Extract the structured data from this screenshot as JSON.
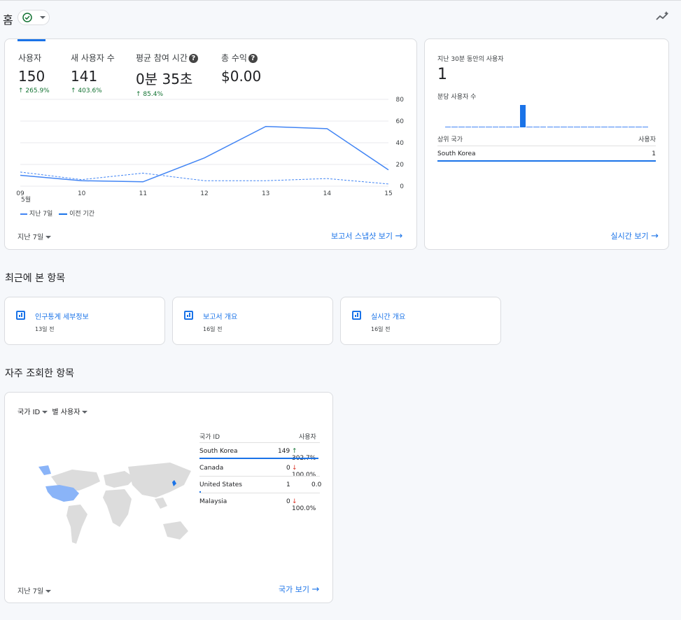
{
  "header": {
    "title": "홈",
    "insights_icon": "sparkline-icon"
  },
  "overview": {
    "metrics": [
      {
        "label": "사용자",
        "value": "150",
        "delta": "265.9%"
      },
      {
        "label": "새 사용자 수",
        "value": "141",
        "delta": "403.6%"
      },
      {
        "label": "평균 참여 시간",
        "value": "0분 35초",
        "delta": "85.4%"
      },
      {
        "label": "총 수익",
        "value": "$0.00",
        "delta": ""
      }
    ],
    "legend_current": "지난 7일",
    "legend_previous": "이전 기간",
    "x_month": "5월",
    "date_range": "지난 7일",
    "link": "보고서 스냅샷 보기"
  },
  "chart_data": {
    "type": "line",
    "x": [
      "09",
      "10",
      "11",
      "12",
      "13",
      "14",
      "15"
    ],
    "xlabel": "",
    "ylabel": "",
    "ylim": [
      0,
      80
    ],
    "yticks": [
      "80",
      "60",
      "40",
      "20",
      "0"
    ],
    "series": [
      {
        "name": "지난 7일",
        "values": [
          10,
          5,
          4,
          26,
          55,
          53,
          15
        ],
        "color": "#4285f4",
        "style": "solid"
      },
      {
        "name": "이전 기간",
        "values": [
          13,
          6,
          12,
          5,
          5,
          7,
          2
        ],
        "color": "#4285f4",
        "style": "dashed"
      }
    ],
    "grid": true
  },
  "realtime": {
    "title": "지난 30분 동안의 사용자",
    "value": "1",
    "per_minute_label": "분당 사용자 수",
    "bars": [
      0,
      0,
      0,
      0,
      0,
      0,
      0,
      0,
      0,
      0,
      0,
      1,
      0,
      0,
      0,
      0,
      0,
      0,
      0,
      0,
      0,
      0,
      0,
      0,
      0,
      0,
      0,
      0,
      0,
      0
    ],
    "table_header_country": "상위 국가",
    "table_header_users": "사용자",
    "rows": [
      {
        "country": "South Korea",
        "users": "1"
      }
    ],
    "link": "실시간 보기"
  },
  "recent": {
    "title": "최근에 본 항목",
    "items": [
      {
        "label": "인구통계 세부정보",
        "time": "13일 전"
      },
      {
        "label": "보고서 개요",
        "time": "16일 전"
      },
      {
        "label": "실시간 개요",
        "time": "16일 전"
      }
    ]
  },
  "frequent": {
    "title": "자주 조회한 항목",
    "dimension": "국가 ID",
    "metric": "별 사용자",
    "table_header_country": "국가 ID",
    "table_header_users": "사용자",
    "rows": [
      {
        "country": "South Korea",
        "users": "149",
        "change": "302.7%",
        "dir": "up"
      },
      {
        "country": "Canada",
        "users": "0",
        "change": "100.0%",
        "dir": "down"
      },
      {
        "country": "United States",
        "users": "1",
        "change": "0.0",
        "dir": "none"
      },
      {
        "country": "Malaysia",
        "users": "0",
        "change": "100.0%",
        "dir": "down"
      }
    ],
    "date_range": "지난 7일",
    "link": "국가 보기"
  }
}
